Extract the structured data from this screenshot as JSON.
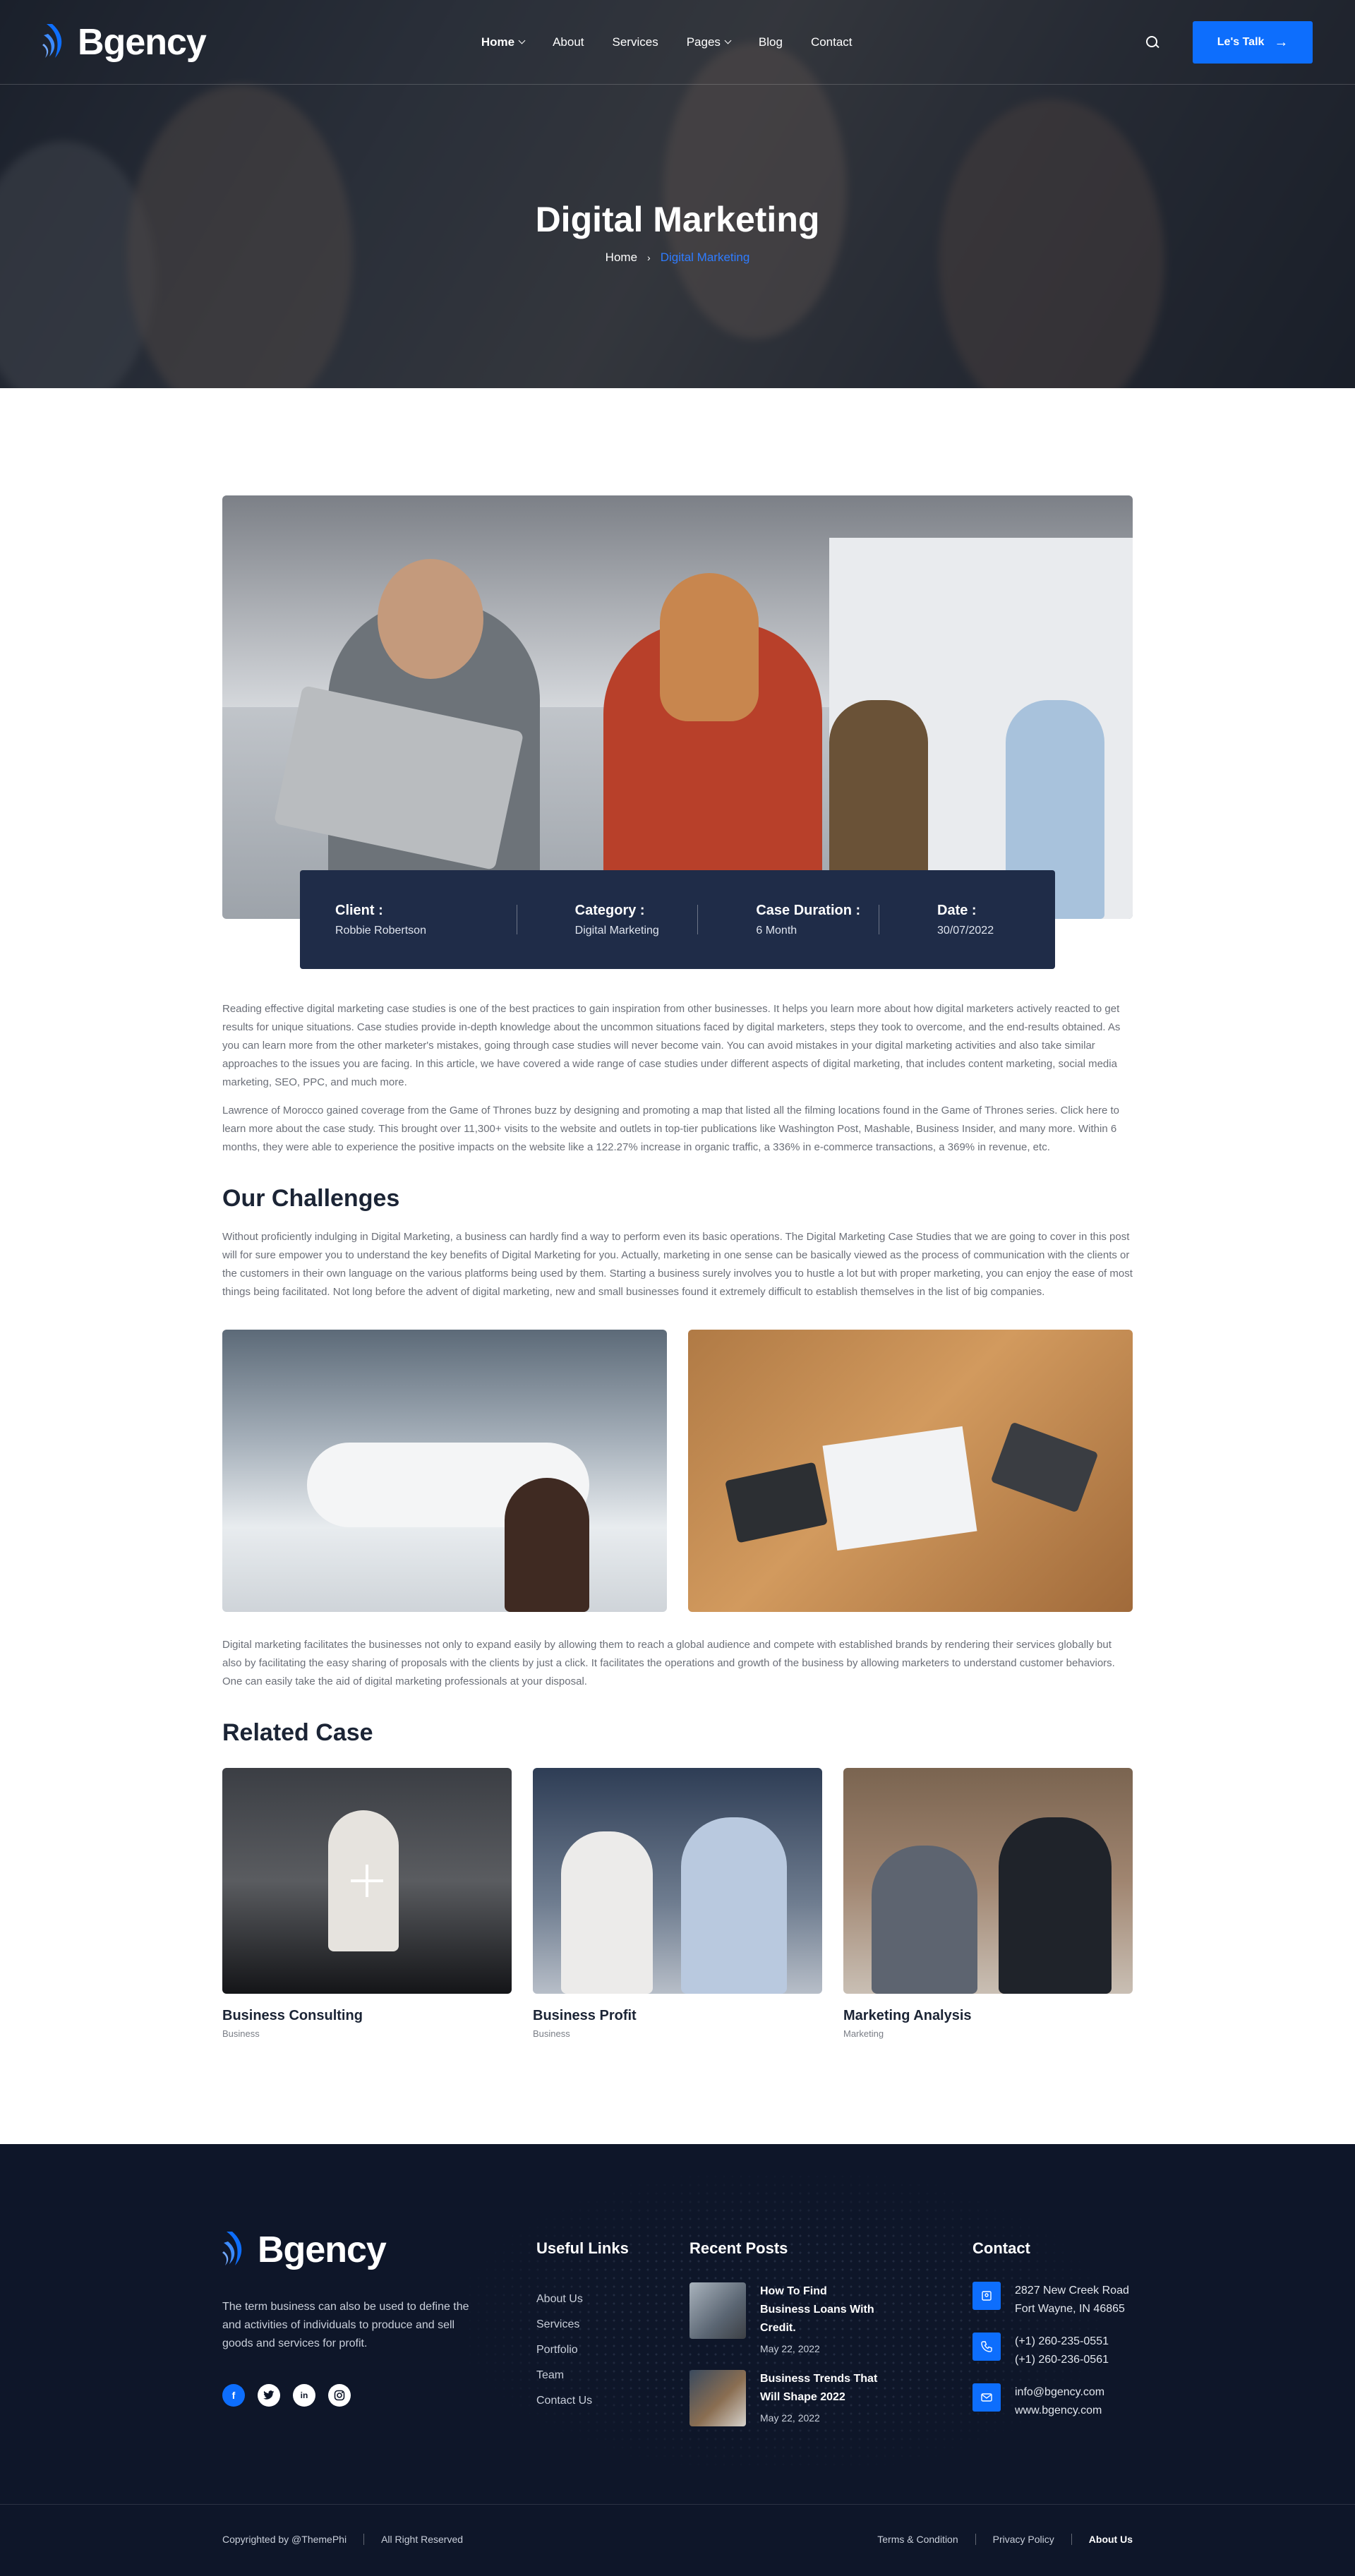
{
  "brand": {
    "name": "Bgency",
    "accent": "#0d6efd",
    "dark": "#1f2c48",
    "footer_bg": "#0e1629"
  },
  "nav": {
    "items": [
      {
        "label": "Home",
        "dropdown": true,
        "active": true
      },
      {
        "label": "About"
      },
      {
        "label": "Services"
      },
      {
        "label": "Pages",
        "dropdown": true
      },
      {
        "label": "Blog"
      },
      {
        "label": "Contact"
      }
    ],
    "search_icon": "search-icon",
    "cta_label": "Le's Talk"
  },
  "hero": {
    "title": "Digital Marketing",
    "breadcrumb": {
      "home": "Home",
      "current": "Digital Marketing"
    }
  },
  "info": [
    {
      "label": "Client :",
      "value": "Robbie Robertson"
    },
    {
      "label": "Category :",
      "value": "Digital Marketing"
    },
    {
      "label": "Case Duration :",
      "value": "6 Month"
    },
    {
      "label": "Date :",
      "value": "30/07/2022"
    }
  ],
  "content": {
    "p1": "Reading effective digital marketing case studies is one of the best practices to gain inspiration from other businesses. It helps you learn more about how digital marketers actively reacted to get results for unique situations. Case studies provide in-depth knowledge about the uncommon situations faced by digital marketers, steps they took to overcome, and the end-results obtained. As you can learn more from the other marketer's mistakes, going through case studies will never become vain. You can avoid mistakes in your digital marketing activities and also take similar approaches to the issues you are facing. In this article, we have covered a wide range of case studies under different aspects of digital marketing, that includes content marketing, social media marketing, SEO, PPC, and much more.",
    "p2": "Lawrence of Morocco gained coverage from the Game of Thrones buzz by designing and promoting a map that listed all the filming locations found in the Game of Thrones series. Click here to learn more about the case study. This brought over 11,300+ visits to the website and outlets in top-tier publications like Washington Post, Mashable, Business Insider, and many more. Within 6 months, they were able to experience the positive impacts on the website like a 122.27% increase in organic traffic, a 336% in e-commerce transactions, a 369% in revenue, etc.",
    "challenges_title": "Our Challenges",
    "p3": "Without proficiently indulging in Digital Marketing, a business can hardly find a way to perform even its basic operations. The Digital Marketing Case Studies that we are going to cover in this post will for sure empower you to understand the key benefits of Digital Marketing for you. Actually, marketing in one sense can be basically viewed as the process of communication with the clients or the customers in their own language on the various platforms being used by them. Starting a business surely involves you to hustle a lot but with proper marketing, you can enjoy the ease of most things being facilitated. Not long before the advent of digital marketing, new and small businesses found it extremely difficult to establish themselves in the list of big companies.",
    "p4": "Digital marketing facilitates the businesses not only to expand easily by allowing them to reach a global audience and compete with established brands by rendering their services globally but also by facilitating the easy sharing of proposals with the clients by just a click. It facilitates the operations and growth of the business by allowing marketers to understand customer behaviors. One can easily take the aid of digital marketing professionals at your disposal.",
    "related_title": "Related Case"
  },
  "related": [
    {
      "title": "Business Consulting",
      "category": "Business"
    },
    {
      "title": "Business Profit",
      "category": "Business"
    },
    {
      "title": "Marketing Analysis",
      "category": "Marketing"
    }
  ],
  "footer": {
    "description": "The term business can also be used to define the and activities of individuals to produce and sell goods and services for profit.",
    "socials": [
      "f",
      "t",
      "in",
      "ig"
    ],
    "links_title": "Useful Links",
    "links": [
      "About Us",
      "Services",
      "Portfolio",
      "Team",
      "Contact Us"
    ],
    "posts_title": "Recent Posts",
    "posts": [
      {
        "title": "How To Find Business Loans With Credit.",
        "date": "May 22, 2022"
      },
      {
        "title": "Business Trends That Will Shape 2022",
        "date": "May 22, 2022"
      }
    ],
    "contact_title": "Contact",
    "address": [
      "2827 New Creek Road",
      "Fort Wayne, IN 46865"
    ],
    "phones": [
      "(+1) 260-235-0551",
      "(+1) 260-236-0561"
    ],
    "emails": [
      "info@bgency.com",
      "www.bgency.com"
    ],
    "copyright": "Copyrighted by @ThemePhi",
    "rights": "All Right Reserved",
    "bottom_links": [
      {
        "label": "Terms & Condition"
      },
      {
        "label": "Privacy Policy"
      },
      {
        "label": "About Us",
        "active": true
      }
    ]
  }
}
